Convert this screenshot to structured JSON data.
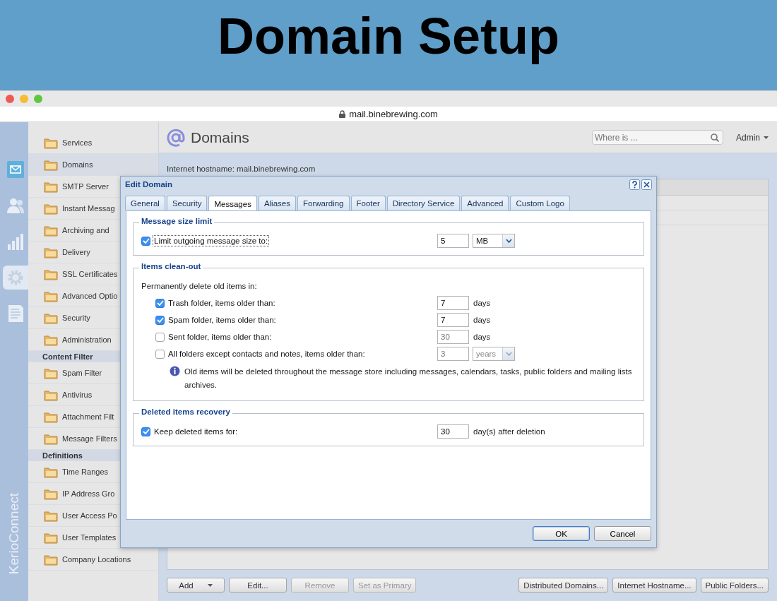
{
  "banner": {
    "title": "Domain Setup"
  },
  "browser": {
    "url": "mail.binebrewing.com"
  },
  "rail": {
    "items": [
      {
        "kind": "mail",
        "selected": false
      },
      {
        "kind": "users",
        "selected": false
      },
      {
        "kind": "chart",
        "selected": false
      },
      {
        "kind": "gear",
        "selected": true
      },
      {
        "kind": "document",
        "selected": false
      }
    ],
    "brand": "KerioConnect"
  },
  "sidebar": {
    "groups": [
      {
        "items": [
          {
            "label": "Services",
            "selected": false
          },
          {
            "label": "Domains",
            "selected": true
          },
          {
            "label": "SMTP Server",
            "selected": false
          },
          {
            "label": "Instant Messag",
            "selected": false
          },
          {
            "label": "Archiving and",
            "selected": false
          },
          {
            "label": "Delivery",
            "selected": false
          },
          {
            "label": "SSL Certificates",
            "selected": false
          },
          {
            "label": "Advanced Optio",
            "selected": false
          },
          {
            "label": "Security",
            "selected": false
          },
          {
            "label": "Administration",
            "selected": false
          }
        ]
      },
      {
        "heading": "Content Filter",
        "items": [
          {
            "label": "Spam Filter",
            "selected": false
          },
          {
            "label": "Antivirus",
            "selected": false
          },
          {
            "label": "Attachment Filt",
            "selected": false
          },
          {
            "label": "Message Filters",
            "selected": false
          }
        ]
      },
      {
        "heading": "Definitions",
        "items": [
          {
            "label": "Time Ranges",
            "selected": false
          },
          {
            "label": "IP Address Gro",
            "selected": false
          },
          {
            "label": "User Access Po",
            "selected": false
          },
          {
            "label": "User Templates",
            "selected": false
          },
          {
            "label": "Company Locations",
            "selected": false
          }
        ]
      }
    ]
  },
  "header": {
    "title": "Domains",
    "search": {
      "placeholder": "Where is ..."
    },
    "user": "Admin"
  },
  "hostname_line": "Internet hostname: mail.binebrewing.com",
  "toolbar": {
    "left": [
      {
        "label": "Add",
        "disabled": false,
        "dropdown": true
      },
      {
        "label": "Edit...",
        "disabled": false,
        "dropdown": false
      },
      {
        "label": "Remove",
        "disabled": true,
        "dropdown": false
      },
      {
        "label": "Set as Primary",
        "disabled": true,
        "dropdown": false
      }
    ],
    "right": [
      {
        "label": "Distributed Domains...",
        "disabled": false,
        "dropdown": false
      },
      {
        "label": "Internet Hostname...",
        "disabled": false,
        "dropdown": false
      },
      {
        "label": "Public Folders...",
        "disabled": false,
        "dropdown": false
      }
    ]
  },
  "dialog": {
    "title": "Edit Domain",
    "tabs": [
      {
        "label": "General",
        "selected": false
      },
      {
        "label": "Security",
        "selected": false
      },
      {
        "label": "Messages",
        "selected": true
      },
      {
        "label": "Aliases",
        "selected": false
      },
      {
        "label": "Forwarding",
        "selected": false
      },
      {
        "label": "Footer",
        "selected": false
      },
      {
        "label": "Directory Service",
        "selected": false
      },
      {
        "label": "Advanced",
        "selected": false
      },
      {
        "label": "Custom Logo",
        "selected": false
      }
    ],
    "sections": [
      {
        "title": "Message size limit",
        "rows": [
          {
            "label": "Limit outgoing message size to:",
            "checked": true,
            "focused": true,
            "value": "5",
            "unit": {
              "kind": "select",
              "text": "MB"
            }
          }
        ]
      },
      {
        "title": "Items clean-out",
        "intro": "Permanently delete old items in:",
        "rows": [
          {
            "label": "Trash folder, items older than:",
            "checked": true,
            "focused": false,
            "value": "7",
            "unit": {
              "kind": "label",
              "text": "days"
            }
          },
          {
            "label": "Spam folder, items older than:",
            "checked": true,
            "focused": false,
            "value": "7",
            "unit": {
              "kind": "label",
              "text": "days"
            }
          },
          {
            "label": "Sent folder, items older than:",
            "checked": false,
            "focused": false,
            "value": "30",
            "unit": {
              "kind": "label",
              "text": "days"
            }
          },
          {
            "label": "All folders except contacts and notes, items older than:",
            "checked": false,
            "focused": false,
            "value": "3",
            "unit": {
              "kind": "select",
              "text": "years"
            }
          }
        ],
        "note": "Old items will be deleted throughout the message store including messages, calendars, tasks, public folders and mailing lists archives."
      },
      {
        "title": "Deleted items recovery",
        "rows": [
          {
            "label": "Keep deleted items for:",
            "checked": true,
            "focused": false,
            "value": "30",
            "unit": {
              "kind": "label",
              "text": "day(s) after deletion"
            }
          }
        ]
      }
    ],
    "buttons": [
      {
        "label": "OK",
        "default": true
      },
      {
        "label": "Cancel",
        "default": false
      }
    ]
  }
}
